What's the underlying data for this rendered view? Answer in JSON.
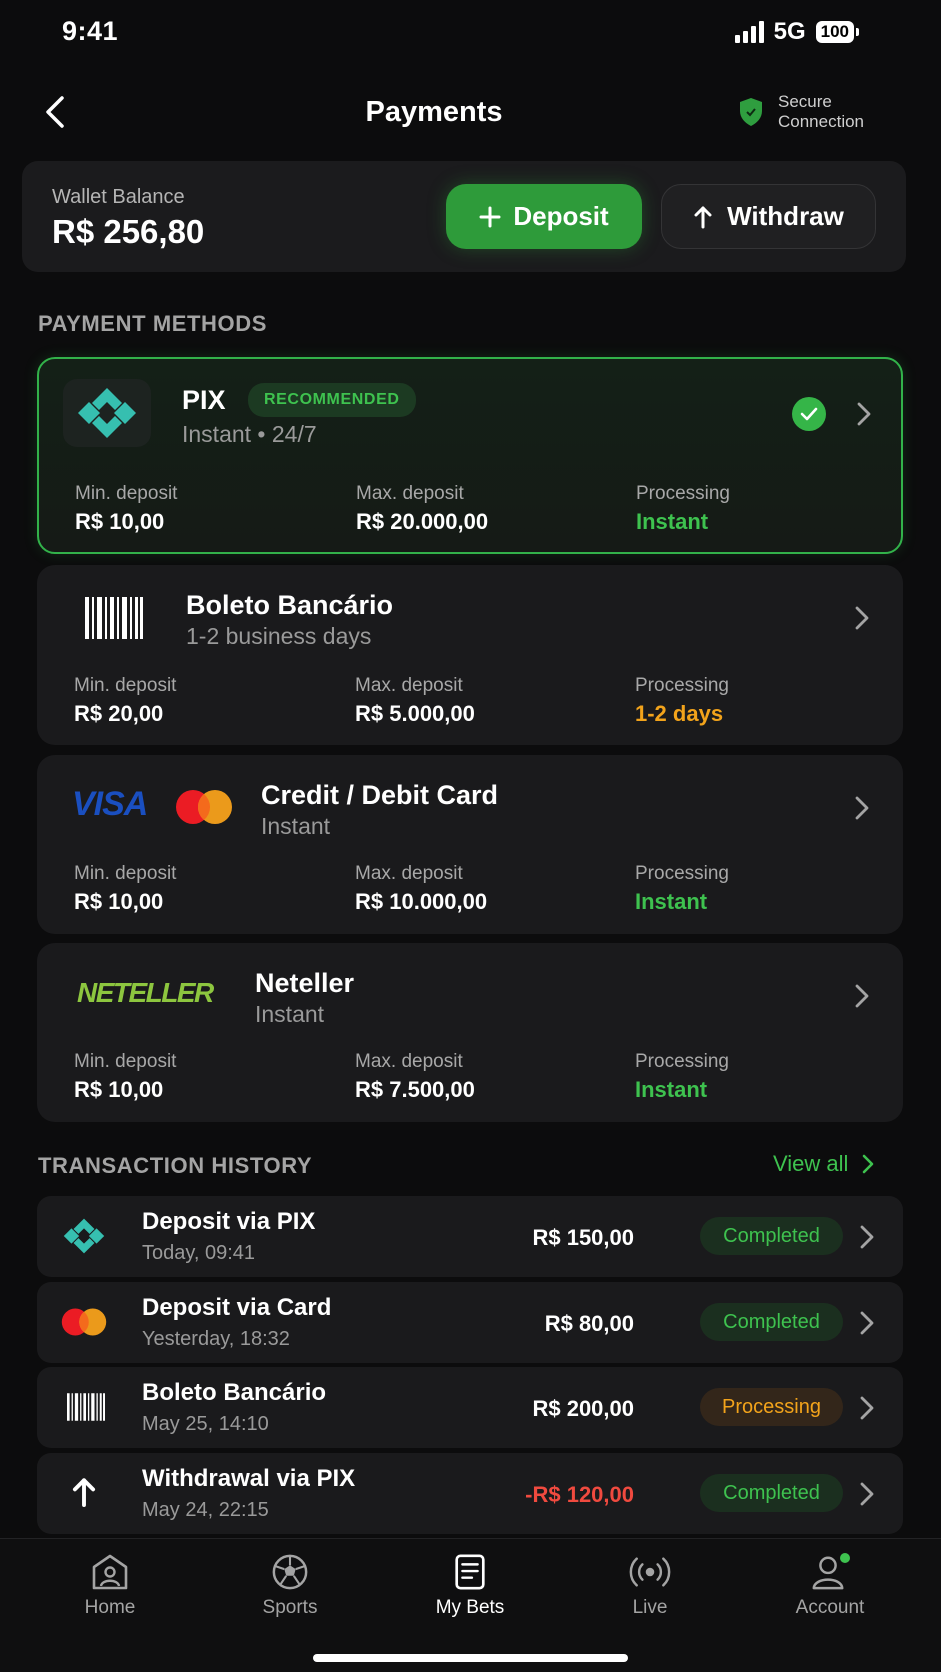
{
  "status": {
    "time": "9:41",
    "network": "5G",
    "battery": "100"
  },
  "header": {
    "title": "Payments",
    "secure_line1": "Secure",
    "secure_line2": "Connection"
  },
  "wallet": {
    "label": "Wallet Balance",
    "amount": "R$ 256,80",
    "deposit_label": "Deposit",
    "withdraw_label": "Withdraw"
  },
  "methods_title": "PAYMENT METHODS",
  "labels": {
    "min": "Min. deposit",
    "max": "Max. deposit",
    "processing": "Processing"
  },
  "methods": [
    {
      "name": "PIX",
      "badge": "RECOMMENDED",
      "sub": "Instant • 24/7",
      "min": "R$ 10,00",
      "max": "R$ 20.000,00",
      "processing": "Instant"
    },
    {
      "name": "Boleto Bancário",
      "sub": "1-2 business days",
      "min": "R$ 20,00",
      "max": "R$ 5.000,00",
      "processing": "1-2 days"
    },
    {
      "name": "Credit / Debit Card",
      "logo_text": "VISA",
      "sub": "Instant",
      "min": "R$ 10,00",
      "max": "R$ 10.000,00",
      "processing": "Instant"
    },
    {
      "name": "Neteller",
      "logo_text": "NETELLER",
      "sub": "Instant",
      "min": "R$ 10,00",
      "max": "R$ 7.500,00",
      "processing": "Instant"
    }
  ],
  "history": {
    "title": "TRANSACTION HISTORY",
    "view_all": "View all",
    "rows": [
      {
        "title": "Deposit via PIX",
        "date": "Today, 09:41",
        "amount": "R$ 150,00",
        "status": "Completed",
        "icon": "pix-icon"
      },
      {
        "title": "Deposit via Card",
        "date": "Yesterday, 18:32",
        "amount": "R$ 80,00",
        "status": "Completed",
        "icon": "mastercard-icon"
      },
      {
        "title": "Boleto Bancário",
        "date": "May 25, 14:10",
        "amount": "R$ 200,00",
        "status": "Processing",
        "icon": "barcode-icon"
      },
      {
        "title": "Withdrawal via PIX",
        "date": "May 24, 22:15",
        "amount": "-R$ 120,00",
        "status": "Completed",
        "icon": "arrow-up-icon"
      }
    ]
  },
  "tabs": [
    {
      "label": "Home",
      "icon": "home-icon"
    },
    {
      "label": "Sports",
      "icon": "soccer-ball-icon"
    },
    {
      "label": "My Bets",
      "icon": "bet-slip-icon",
      "active": true
    },
    {
      "label": "Live",
      "icon": "live-broadcast-icon"
    },
    {
      "label": "Account",
      "icon": "user-icon"
    }
  ],
  "colors": {
    "accent": "#2e9b3a",
    "success": "#3ec24f",
    "warning": "#f2a31b",
    "danger": "#f04a3f",
    "background": "#0c0c0d",
    "card": "#1a1a1c"
  }
}
